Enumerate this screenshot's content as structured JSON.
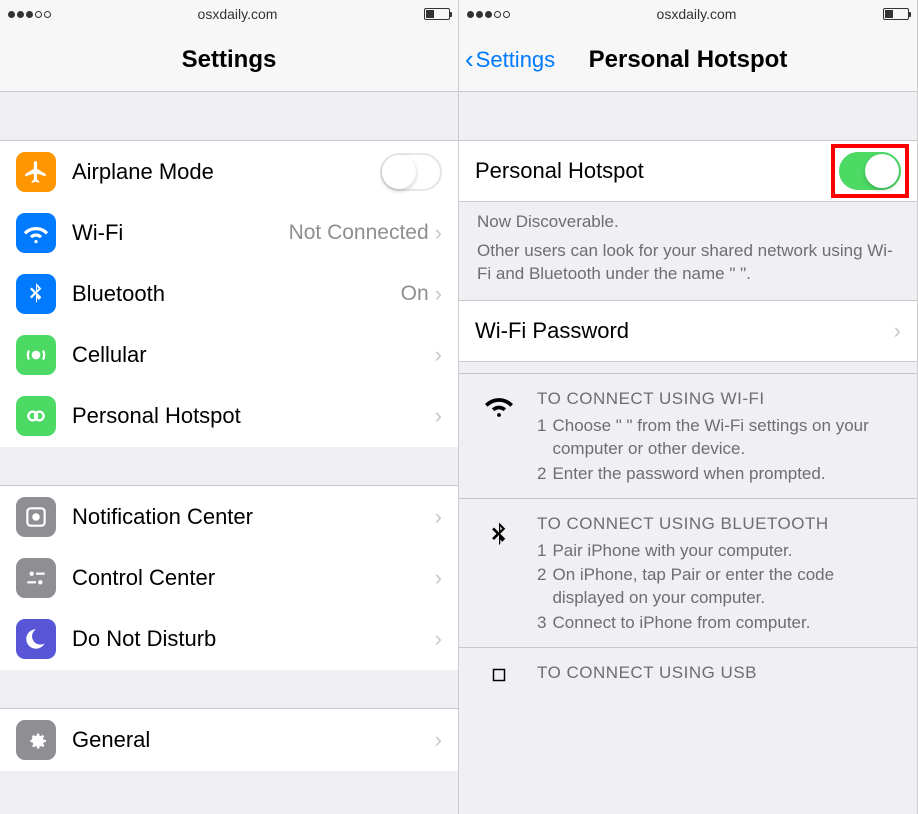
{
  "left": {
    "status": {
      "domain": "osxdaily.com"
    },
    "nav": {
      "title": "Settings"
    },
    "rows": {
      "airplane": {
        "label": "Airplane Mode"
      },
      "wifi": {
        "label": "Wi-Fi",
        "value": "Not Connected"
      },
      "bluetooth": {
        "label": "Bluetooth",
        "value": "On"
      },
      "cellular": {
        "label": "Cellular"
      },
      "hotspot": {
        "label": "Personal Hotspot"
      },
      "notif": {
        "label": "Notification Center"
      },
      "control": {
        "label": "Control Center"
      },
      "dnd": {
        "label": "Do Not Disturb"
      },
      "general": {
        "label": "General"
      }
    }
  },
  "right": {
    "status": {
      "domain": "osxdaily.com"
    },
    "nav": {
      "back": "Settings",
      "title": "Personal Hotspot"
    },
    "toggle": {
      "label": "Personal Hotspot"
    },
    "discover": {
      "line1": "Now Discoverable.",
      "line2": "Other users can look for your shared network using Wi-Fi and Bluetooth under the name \"                          \"."
    },
    "wifipw": {
      "label": "Wi-Fi Password"
    },
    "instr_wifi": {
      "title": "TO CONNECT USING WI-FI",
      "s1": "Choose \"                         \" from the Wi-Fi settings on your computer or other device.",
      "s2": "Enter the password when prompted."
    },
    "instr_bt": {
      "title": "TO CONNECT USING BLUETOOTH",
      "s1": "Pair iPhone with your computer.",
      "s2": "On iPhone, tap Pair or enter the code displayed on your computer.",
      "s3": "Connect to iPhone from computer."
    },
    "instr_usb": {
      "title": "TO CONNECT USING USB"
    }
  }
}
